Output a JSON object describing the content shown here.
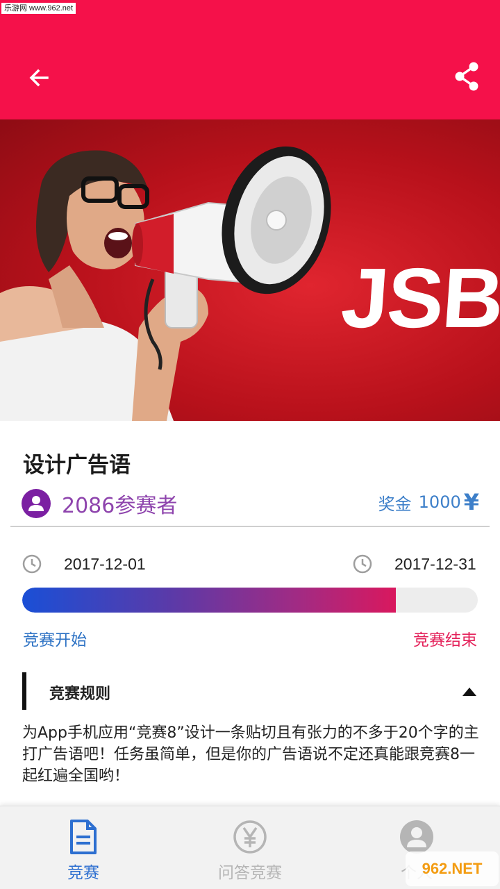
{
  "watermark_top": "乐游网 www.962.net",
  "appbar": {
    "background": "#f5114a",
    "back_icon": "arrow-left-icon",
    "share_icon": "share-icon"
  },
  "banner": {
    "text": "JSB",
    "background": "#c4141e"
  },
  "contest": {
    "title": "设计广告语",
    "participants": "2086参赛者",
    "prize_label": "奖金",
    "prize_amount": "1000",
    "prize_currency": "¥"
  },
  "dates": {
    "start": "2017-12-01",
    "end": "2017-12-31",
    "start_label": "竞赛开始",
    "end_label": "竞赛结束",
    "progress_fraction": 0.82
  },
  "rules": {
    "title": "竞赛规则",
    "body": "为App手机应用“竞赛8”设计一条贴切且有张力的不多于20个字的主打广告语吧！任务虽简单，但是你的广告语说不定还真能跟竞赛8一起红遍全国哟！"
  },
  "bottom_nav": [
    {
      "label": "竞赛",
      "icon": "document-icon",
      "active": true
    },
    {
      "label": "问答竞赛",
      "icon": "yen-coin-icon",
      "active": false
    },
    {
      "label": "个人",
      "icon": "person-icon",
      "active": false
    }
  ],
  "watermark_bottom": "962.NET"
}
